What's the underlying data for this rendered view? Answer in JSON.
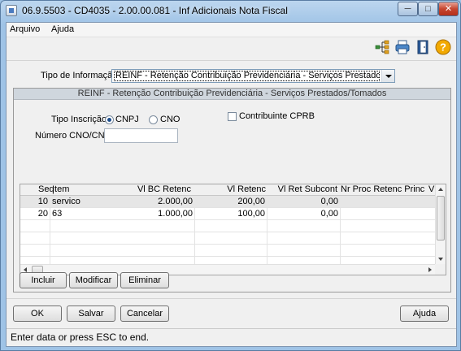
{
  "window": {
    "title": "06.9.5503 - CD4035 - 2.00.00.081 - Inf Adicionais Nota Fiscal",
    "min_label": "─",
    "max_label": "□",
    "close_label": "✕"
  },
  "menu": {
    "items": [
      "Arquivo",
      "Ajuda"
    ]
  },
  "toolbar": {
    "icons": [
      "tree-structure-icon",
      "printer-icon",
      "exit-door-icon",
      "help-icon"
    ],
    "help_glyph": "?"
  },
  "form": {
    "tipo_informacao_label": "Tipo de Informação:",
    "tipo_informacao_value": "REINF - Retenção Contribuição Previdenciária - Serviços Prestados/Tomados"
  },
  "group": {
    "title": "REINF - Retenção Contribuição Previdenciária - Serviços Prestados/Tomados",
    "tipo_inscricao_label": "Tipo Inscrição:",
    "radio_cnpj": "CNPJ",
    "radio_cno": "CNO",
    "selected": "CNPJ",
    "contribuinte_label": "Contribuinte CPRB",
    "contribuinte_checked": false,
    "numero_label": "Número CNO/CNPJ:",
    "numero_value": ""
  },
  "grid": {
    "columns": [
      "Seq",
      "Item",
      "Vl BC Retenc",
      "Vl Retenc",
      "Vl Ret Subcont",
      "Nr Proc Retenc Princ",
      "Vl I"
    ],
    "rows": [
      [
        "10",
        "servico",
        "2.000,00",
        "200,00",
        "0,00",
        "",
        ""
      ],
      [
        "20",
        "63",
        "1.000,00",
        "100,00",
        "0,00",
        "",
        ""
      ]
    ]
  },
  "grid_buttons": {
    "incluir": "Incluir",
    "modificar": "Modificar",
    "eliminar": "Eliminar"
  },
  "footer_buttons": {
    "ok": "OK",
    "salvar": "Salvar",
    "cancelar": "Cancelar",
    "ajuda": "Ajuda"
  },
  "status": {
    "text": "Enter data or press ESC to end."
  },
  "colors": {
    "title_gradient": "#bcd6ef",
    "help_icon": "#f2a900",
    "selected_row": "#e6e6e6"
  }
}
